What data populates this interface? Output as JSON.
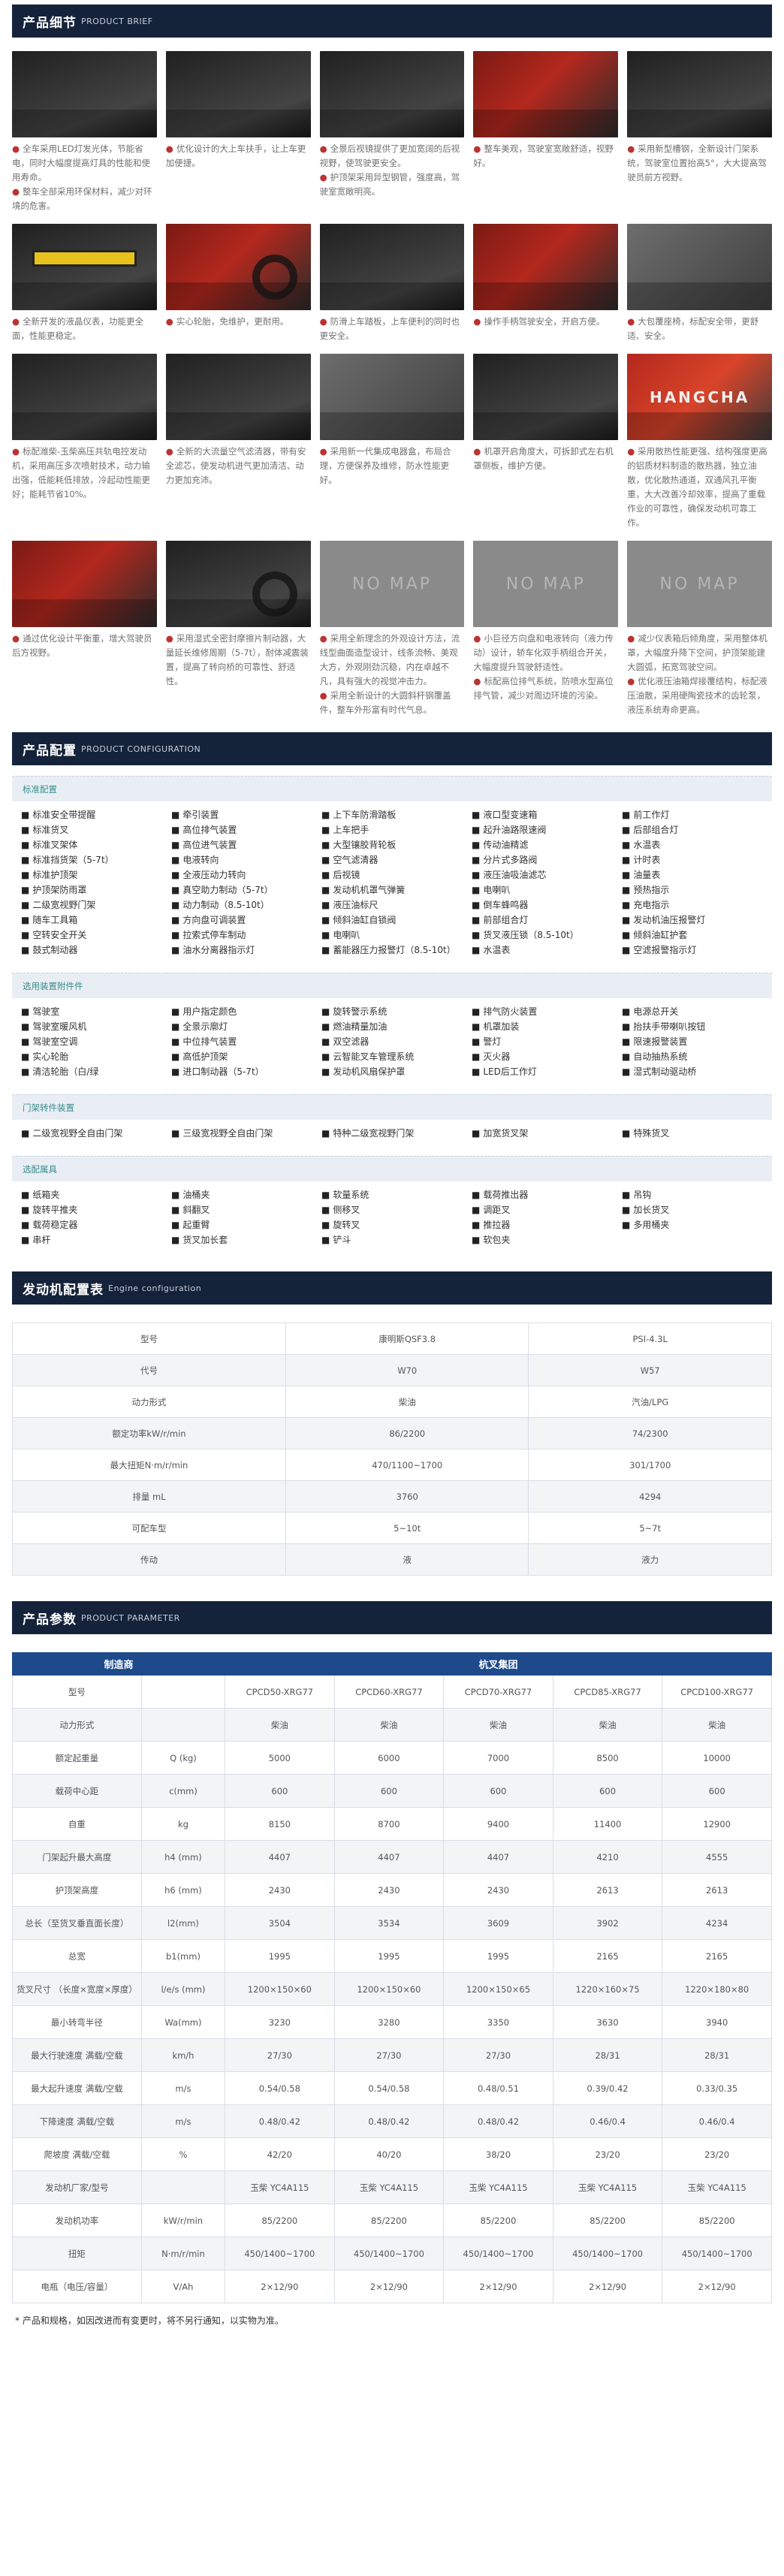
{
  "brief": {
    "title": "产品细节",
    "subtitle": "PRODUCT BRIEF",
    "nomap_label": "NO MAP",
    "logo_text": "HANGCHA",
    "items": [
      {
        "lines": [
          "全车采用LED灯发光体，节能省电，同时大幅度提高灯具的性能和使用寿命。",
          "整车全部采用环保材料，减少对环境的危害。"
        ]
      },
      {
        "lines": [
          "优化设计的大上车扶手，让上车更加便捷。"
        ]
      },
      {
        "lines": [
          "全景后视镜提供了更加宽阔的后视视野，使驾驶更安全。",
          "护顶架采用异型钢管，强度高，驾驶室宽敞明亮。"
        ]
      },
      {
        "lines": [
          "整车美观，驾驶室宽敞舒适，视野好。"
        ]
      },
      {
        "lines": [
          "采用新型槽钢，全新设计门架系统，驾驶室位置抬高5°，大大提高驾驶员前方视野。"
        ]
      },
      {
        "lines": [
          "全新开发的液晶仪表，功能更全面，性能更稳定。"
        ]
      },
      {
        "lines": [
          "实心轮胎，免维护，更耐用。"
        ]
      },
      {
        "lines": [
          "防滑上车踏板，上车便利的同时也更安全。"
        ]
      },
      {
        "lines": [
          "操作手柄驾驶安全，开启方便。"
        ]
      },
      {
        "lines": [
          "大包覆座椅，标配安全带，更舒适、安全。"
        ]
      },
      {
        "lines": [
          "标配潍柴-玉柴高压共轨电控发动机，采用高压多次喷射技术，动力输出强，低能耗低排放，冷起动性能更好；能耗节省10%。"
        ]
      },
      {
        "lines": [
          "全新的大流量空气滤清器，带有安全滤芯，使发动机进气更加清洁、动力更加充沛。"
        ]
      },
      {
        "lines": [
          "采用新一代集成电器盒，布局合理，方便保养及维修，防水性能更好。"
        ]
      },
      {
        "lines": [
          "机罩开启角度大，可拆卸式左右机罩侧板，维护方便。"
        ]
      },
      {
        "lines": [
          "采用散热性能更强、结构强度更高的铝质材料制造的散热器，独立油散，优化散热通道，双通风孔平衡重，大大改善冷却效率，提高了重载作业的可靠性，确保发动机可靠工作。"
        ]
      },
      {
        "lines": [
          "通过优化设计平衡重，增大驾驶员后方视野。"
        ]
      },
      {
        "lines": [
          "采用湿式全密封摩擦片制动器，大量延长维修周期（5-7t），耐体减震装置，提高了转向桥的可靠性、舒适性。"
        ]
      },
      {
        "lines": [
          "采用全新理念的外观设计方法，流线型曲面造型设计，线条流畅、美观大方，外观刚劲沉稳，内在卓越不凡，具有强大的视觉冲击力。",
          "采用全新设计的大圆斜杆钢覆盖件，整车外形富有时代气息。"
        ]
      },
      {
        "lines": [
          "小巨径方向盘和电液转向（液力传动）设计，轿车化双手柄组合开关，大幅度提升驾驶舒适性。",
          "标配高位排气系统，防喷水型高位排气管，减少对周边环境的污染。"
        ]
      },
      {
        "lines": [
          "减少仪表箱后倾角度，采用整体机罩，大幅度升降下空间，护顶架能建大圆弧，拓宽驾驶空间。",
          "优化液压油箱焊接覆结构，标配液压油散，采用硬陶瓷技术的齿轮泵，液压系统寿命更高。"
        ]
      }
    ]
  },
  "config": {
    "title": "产品配置",
    "subtitle": "PRODUCT CONFIGURATION",
    "groups": [
      {
        "name": "标准配置",
        "items": [
          "标准安全带提醒",
          "牵引装置",
          "上下车防滑踏板",
          "液口型变速箱",
          "前工作灯",
          "标准货叉",
          "高位排气装置",
          "上车把手",
          "起升油路限速阀",
          "后部组合灯",
          "标准叉架体",
          "高位进气装置",
          "大型镶胶背轮板",
          "传动油精滤",
          "水温表",
          "标准挡货架（5-7t）",
          "电液转向",
          "空气滤清器",
          "分片式多路阀",
          "计时表",
          "标准护顶架",
          "全液压动力转向",
          "后视镜",
          "液压油吸油滤芯",
          "油量表",
          "护顶架防雨罩",
          "真空助力制动（5-7t）",
          "发动机机罩气弹簧",
          "电喇叭",
          "预热指示",
          "二级宽视野门架",
          "动力制动（8.5-10t）",
          "液压油标尺",
          "倒车蜂鸣器",
          "充电指示",
          "随车工具箱",
          "方向盘可调装置",
          "倾斜油缸自锁阀",
          "前部组合灯",
          "发动机油压报警灯",
          "空转安全开关",
          "拉索式停车制动",
          "电喇叭",
          "货叉液压锁（8.5-10t）",
          "倾斜油缸护套",
          "鼓式制动器",
          "油水分离器指示灯",
          "蓄能器压力报警灯（8.5-10t）",
          "水温表",
          "空滤报警指示灯"
        ]
      },
      {
        "name": "选用装置附件件",
        "items": [
          "驾驶室",
          "用户指定颜色",
          "旋转警示系统",
          "排气防火装置",
          "电源总开关",
          "驾驶室暖风机",
          "全景示廓灯",
          "燃油精量加油",
          "机罩加装",
          "抬扶手带喇叭按钮",
          "驾驶室空调",
          "中位排气装置",
          "双空滤器",
          "警灯",
          "限速报警装置",
          "实心轮胎",
          "高低护顶架",
          "云智能叉车管理系统",
          "灭火器",
          "自动抽热系统",
          "清洁轮胎（白/绿",
          "进口制动器（5-7t）",
          "发动机风扇保护罩",
          "LED后工作灯",
          "湿式制动驱动桥"
        ]
      },
      {
        "name": "门架转件装置",
        "items": [
          "二级宽视野全自由门架",
          "三级宽视野全自由门架",
          "特种二级宽视野门架",
          "加宽货叉架",
          "特殊货叉"
        ]
      },
      {
        "name": "选配属具",
        "items": [
          "纸箱夹",
          "油桶夹",
          "软量系统",
          "载荷推出器",
          "吊钩",
          "旋转平推夹",
          "斜翻叉",
          "侧移叉",
          "调距叉",
          "加长货叉",
          "载荷稳定器",
          "起重臂",
          "旋转叉",
          "推拉器",
          "多用桶夹",
          "串杆",
          "货叉加长套",
          "铲斗",
          "软包夹"
        ]
      }
    ]
  },
  "engine": {
    "title": "发动机配置表",
    "subtitle": "Engine configuration",
    "rows": [
      [
        "型号",
        "康明斯QSF3.8",
        "PSI-4.3L"
      ],
      [
        "代号",
        "W70",
        "W57"
      ],
      [
        "动力形式",
        "柴油",
        "汽油/LPG"
      ],
      [
        "额定功率kW/r/min",
        "86/2200",
        "74/2300"
      ],
      [
        "最大扭矩N·m/r/min",
        "470/1100~1700",
        "301/1700"
      ],
      [
        "排量 mL",
        "3760",
        "4294"
      ],
      [
        "可配车型",
        "5~10t",
        "5~7t"
      ],
      [
        "传动",
        "液",
        "液力"
      ]
    ]
  },
  "params": {
    "title": "产品参数",
    "subtitle": "PRODUCT PARAMETER",
    "head": [
      "制造商",
      "杭叉集团"
    ],
    "rows": [
      [
        "型号",
        "",
        "CPCD50-XRG77",
        "CPCD60-XRG77",
        "CPCD70-XRG77",
        "CPCD85-XRG77",
        "CPCD100-XRG77"
      ],
      [
        "动力形式",
        "",
        "柴油",
        "柴油",
        "柴油",
        "柴油",
        "柴油"
      ],
      [
        "额定起重量",
        "Q (kg)",
        "5000",
        "6000",
        "7000",
        "8500",
        "10000"
      ],
      [
        "载荷中心距",
        "c(mm)",
        "600",
        "600",
        "600",
        "600",
        "600"
      ],
      [
        "自重",
        "kg",
        "8150",
        "8700",
        "9400",
        "11400",
        "12900"
      ],
      [
        "门架起升最大高度",
        "h4 (mm)",
        "4407",
        "4407",
        "4407",
        "4210",
        "4555"
      ],
      [
        "护顶架高度",
        "h6 (mm)",
        "2430",
        "2430",
        "2430",
        "2613",
        "2613"
      ],
      [
        "总长（至货叉垂直面长度）",
        "l2(mm)",
        "3504",
        "3534",
        "3609",
        "3902",
        "4234"
      ],
      [
        "总宽",
        "b1(mm)",
        "1995",
        "1995",
        "1995",
        "2165",
        "2165"
      ],
      [
        "货叉尺寸 （长度×宽度×厚度）",
        "l/e/s (mm)",
        "1200×150×60",
        "1200×150×60",
        "1200×150×65",
        "1220×160×75",
        "1220×180×80"
      ],
      [
        "最小转弯半径",
        "Wa(mm)",
        "3230",
        "3280",
        "3350",
        "3630",
        "3940"
      ],
      [
        "最大行驶速度 满载/空载",
        "km/h",
        "27/30",
        "27/30",
        "27/30",
        "28/31",
        "28/31"
      ],
      [
        "最大起升速度 满载/空载",
        "m/s",
        "0.54/0.58",
        "0.54/0.58",
        "0.48/0.51",
        "0.39/0.42",
        "0.33/0.35"
      ],
      [
        "下降速度 满载/空载",
        "m/s",
        "0.48/0.42",
        "0.48/0.42",
        "0.48/0.42",
        "0.46/0.4",
        "0.46/0.4"
      ],
      [
        "爬坡度 满载/空载",
        "%",
        "42/20",
        "40/20",
        "38/20",
        "23/20",
        "23/20"
      ],
      [
        "发动机厂家/型号",
        "",
        "玉柴 YC4A115",
        "玉柴 YC4A115",
        "玉柴 YC4A115",
        "玉柴 YC4A115",
        "玉柴 YC4A115"
      ],
      [
        "发动机功率",
        "kW/r/min",
        "85/2200",
        "85/2200",
        "85/2200",
        "85/2200",
        "85/2200"
      ],
      [
        "扭矩",
        "N·m/r/min",
        "450/1400~1700",
        "450/1400~1700",
        "450/1400~1700",
        "450/1400~1700",
        "450/1400~1700"
      ],
      [
        "电瓶（电压/容量）",
        "V/Ah",
        "2×12/90",
        "2×12/90",
        "2×12/90",
        "2×12/90",
        "2×12/90"
      ]
    ],
    "footnote": "* 产品和规格，如因改进而有变更时，将不另行通知，以实物为准。"
  }
}
